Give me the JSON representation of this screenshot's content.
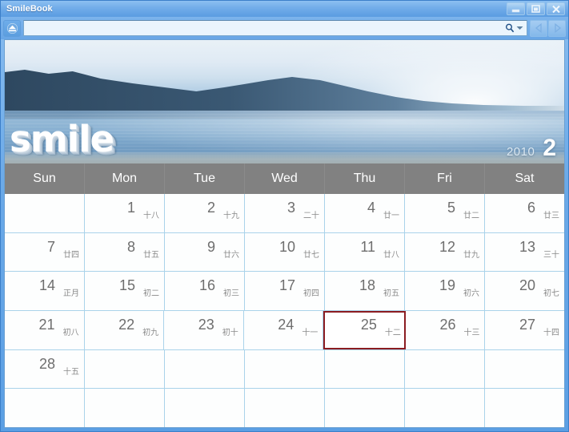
{
  "window": {
    "title": "SmileBook",
    "buttons": [
      {
        "name": "minimize",
        "label": "–"
      },
      {
        "name": "maximize",
        "label": "□"
      },
      {
        "name": "close",
        "label": "✕"
      }
    ]
  },
  "toolbar": {
    "eject_icon": "eject-icon",
    "search": {
      "value": "",
      "placeholder": ""
    },
    "search_icon": "search-icon",
    "dropdown_icon": "chevron-down-icon",
    "prev_label": "◁",
    "next_label": "▷",
    "prev_icon": "triangle-left-icon",
    "next_icon": "triangle-right-icon"
  },
  "hero": {
    "logo": "smile",
    "year": "2010",
    "month": "2",
    "image_description": "coastal mountain silhouette over calm ocean at dawn"
  },
  "calendar": {
    "weekdays": [
      "Sun",
      "Mon",
      "Tue",
      "Wed",
      "Thu",
      "Fri",
      "Sat"
    ],
    "selected_day": 25,
    "header_bg": "#818181",
    "grid_line_color": "#aad3ea",
    "selected_border_color": "#8b1c21",
    "weeks": [
      [
        {
          "day": "",
          "lunar": ""
        },
        {
          "day": "1",
          "lunar": "十八"
        },
        {
          "day": "2",
          "lunar": "十九"
        },
        {
          "day": "3",
          "lunar": "二十"
        },
        {
          "day": "4",
          "lunar": "廿一"
        },
        {
          "day": "5",
          "lunar": "廿二"
        },
        {
          "day": "6",
          "lunar": "廿三"
        }
      ],
      [
        {
          "day": "7",
          "lunar": "廿四"
        },
        {
          "day": "8",
          "lunar": "廿五"
        },
        {
          "day": "9",
          "lunar": "廿六"
        },
        {
          "day": "10",
          "lunar": "廿七"
        },
        {
          "day": "11",
          "lunar": "廿八"
        },
        {
          "day": "12",
          "lunar": "廿九"
        },
        {
          "day": "13",
          "lunar": "三十"
        }
      ],
      [
        {
          "day": "14",
          "lunar": "正月"
        },
        {
          "day": "15",
          "lunar": "初二"
        },
        {
          "day": "16",
          "lunar": "初三"
        },
        {
          "day": "17",
          "lunar": "初四"
        },
        {
          "day": "18",
          "lunar": "初五"
        },
        {
          "day": "19",
          "lunar": "初六"
        },
        {
          "day": "20",
          "lunar": "初七"
        }
      ],
      [
        {
          "day": "21",
          "lunar": "初八"
        },
        {
          "day": "22",
          "lunar": "初九"
        },
        {
          "day": "23",
          "lunar": "初十"
        },
        {
          "day": "24",
          "lunar": "十一"
        },
        {
          "day": "25",
          "lunar": "十二",
          "selected": true
        },
        {
          "day": "26",
          "lunar": "十三"
        },
        {
          "day": "27",
          "lunar": "十四"
        }
      ],
      [
        {
          "day": "28",
          "lunar": "十五"
        },
        {
          "day": "",
          "lunar": ""
        },
        {
          "day": "",
          "lunar": ""
        },
        {
          "day": "",
          "lunar": ""
        },
        {
          "day": "",
          "lunar": ""
        },
        {
          "day": "",
          "lunar": ""
        },
        {
          "day": "",
          "lunar": ""
        }
      ],
      [
        {
          "day": "",
          "lunar": ""
        },
        {
          "day": "",
          "lunar": ""
        },
        {
          "day": "",
          "lunar": ""
        },
        {
          "day": "",
          "lunar": ""
        },
        {
          "day": "",
          "lunar": ""
        },
        {
          "day": "",
          "lunar": ""
        },
        {
          "day": "",
          "lunar": ""
        }
      ]
    ]
  }
}
